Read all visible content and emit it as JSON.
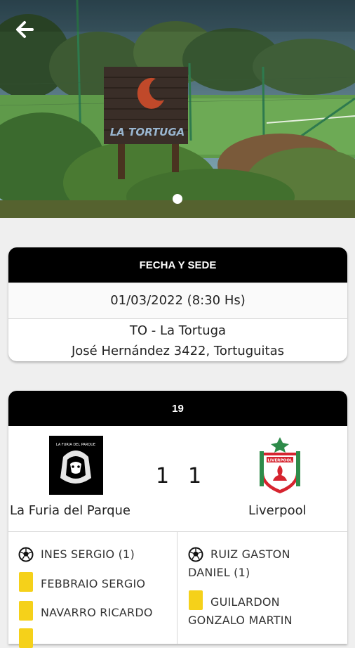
{
  "venue_card": {
    "header": "FECHA Y SEDE",
    "datetime": "01/03/2022 (8:30 Hs)",
    "venue_name": "TO - La Tortuga",
    "address": "José Hernández 3422, Tortuguitas"
  },
  "hero": {
    "sign_text": "LA TORTUGA"
  },
  "match_card": {
    "header": "19",
    "home": {
      "name": "La Furia del Parque",
      "score": "1",
      "logo_text": "LA FURIA DEL PARQUE"
    },
    "away": {
      "name": "Liverpool",
      "score": "1",
      "logo_text": "LIVERPOOL"
    },
    "home_events": [
      {
        "type": "goal",
        "text": "INES SERGIO (1)"
      },
      {
        "type": "yellow-card",
        "text": "FEBBRAIO SERGIO"
      },
      {
        "type": "yellow-card",
        "text": "NAVARRO RICARDO"
      }
    ],
    "away_events": [
      {
        "type": "goal",
        "line1": "RUIZ GASTON",
        "line2": "DANIEL (1)"
      },
      {
        "type": "yellow-card",
        "line1": "GUILARDON",
        "line2": "GONZALO MARTIN"
      }
    ]
  },
  "colors": {
    "header": "#000000",
    "yellow_card": "#f5d11a",
    "background": "#efefef"
  }
}
